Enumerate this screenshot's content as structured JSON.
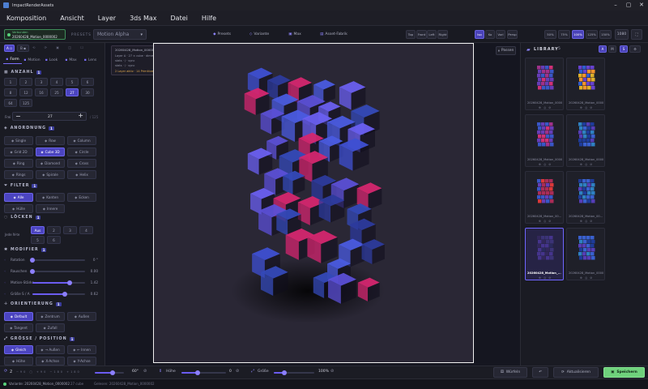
{
  "window": {
    "title": "ImpactRenderAssets"
  },
  "menu": [
    "Komposition",
    "Ansicht",
    "Layer",
    "3ds Max",
    "Datei",
    "Hilfe"
  ],
  "toolbar": {
    "badge_label": "Verbunden",
    "badge_value": "20260428_Motion_0000002",
    "preset_caption": "PRESETS",
    "preset_value": "Motion Alpha",
    "center_buttons": [
      "Presets",
      "Variante",
      "Max",
      "Asset-Fabrik"
    ],
    "views": [
      "Top",
      "Front",
      "Left",
      "Right",
      "Iso",
      "Ko",
      "Vorl",
      "Persp"
    ],
    "zoom": [
      "50%",
      "75%",
      "100%",
      "125%",
      "150%"
    ],
    "zoom_selected": "100%",
    "resolution": "1080"
  },
  "left": {
    "tabs": [
      "Form",
      "Motion",
      "Look",
      "Max",
      "Lens"
    ],
    "anzahl": {
      "title": "ANZAHL",
      "count": "1",
      "values": [
        "1",
        "2",
        "3",
        "4",
        "5",
        "6",
        "8",
        "12",
        "16",
        "25",
        "27",
        "30",
        "64",
        "125"
      ],
      "selected": "27",
      "stepper_label": "Frei",
      "stepper_value": "27",
      "stepper_max": "/ 125"
    },
    "anordnung": {
      "title": "ANORDNUNG",
      "count": "1",
      "options": [
        "Single",
        "Row",
        "Column",
        "Grid 2D",
        "Cube 3D",
        "Circle",
        "Ring",
        "Diamond",
        "Cross",
        "Rings",
        "Spirale",
        "Helix"
      ],
      "selected": "Cube 3D"
    },
    "filter": {
      "title": "FILTER",
      "count": "1",
      "options": [
        "Alle",
        "Kanten",
        "Ecken",
        "Hülle",
        "Innere"
      ],
      "selected": "Alle"
    },
    "locken": {
      "title": "LÖCKEN",
      "count": "1",
      "label": "Jede N-te",
      "options": [
        "Aus",
        "2",
        "3",
        "4",
        "5",
        "6"
      ],
      "selected": "Aus"
    },
    "modifier": {
      "title": "MODIFIER",
      "count": "1",
      "sliders": [
        {
          "label": "Rotation",
          "value": "0 °",
          "frac": 0.0
        },
        {
          "label": "Rauschen",
          "value": "0.00",
          "frac": 0.0
        },
        {
          "label": "Motion-Stärke",
          "value": "1.42",
          "frac": 0.71
        },
        {
          "label": "Größe S / A",
          "value": "0.62",
          "frac": 0.62
        }
      ]
    },
    "orientierung": {
      "title": "ORIENTIERUNG",
      "count": "1",
      "options": [
        "Default",
        "Zentrum",
        "Außen",
        "Tangent",
        "Zufall"
      ],
      "selected": "Default"
    },
    "groesse": {
      "title": "GRÖSSE / POSITION",
      "count": "1",
      "options": [
        "Gleich",
        "→ Außen",
        "← Innen",
        "Höhe",
        "X-Achse",
        "Y-Achse"
      ],
      "selected": "Gleich"
    }
  },
  "overlay": {
    "id": "20260428_Motion_0000002",
    "line1": "Layer A · 27 × cube · dimmed",
    "line2": "stats · / · sync",
    "line3": "stats · / · sync",
    "line4": "2 Layer aktiv · 14 Primitive gespawnt"
  },
  "fit_button": "Passen",
  "library": {
    "title": "LIBRARY",
    "count": "5",
    "filter_tabs": [
      "A",
      "M",
      "S"
    ],
    "items": [
      {
        "caption": "20260428_Motion_0000",
        "hue": "pink"
      },
      {
        "caption": "20260428_Motion_0000",
        "hue": "orange"
      },
      {
        "caption": "20260428_Motion_0000",
        "hue": "pink"
      },
      {
        "caption": "20260428_Motion_0000",
        "hue": "blue"
      },
      {
        "caption": "20260428_Motion_000...",
        "hue": "red"
      },
      {
        "caption": "20260428_Motion_000...",
        "hue": "blue"
      },
      {
        "caption": "20260428_Motion_...",
        "hue": "dark",
        "selected": true
      },
      {
        "caption": "20260428_Motion_0000",
        "hue": "blue"
      }
    ]
  },
  "bottom": {
    "pager": "2",
    "angle_value": "60°",
    "hoehe_label": "Höhe",
    "hoehe_value": "0",
    "groesse_label": "Größe",
    "groesse_value": "100%",
    "wuerfeln": "Würfeln",
    "aktualisieren": "Aktualisieren",
    "speichern": "Speichern"
  },
  "status": {
    "variant": "Variante: 20260428_Motion_0000002",
    "cubes": "27 cube",
    "selected": "Gelesen: 20260428_Motion_0000002"
  },
  "colors": {
    "accent": "#6b5cf0",
    "save": "#6fd17c"
  }
}
